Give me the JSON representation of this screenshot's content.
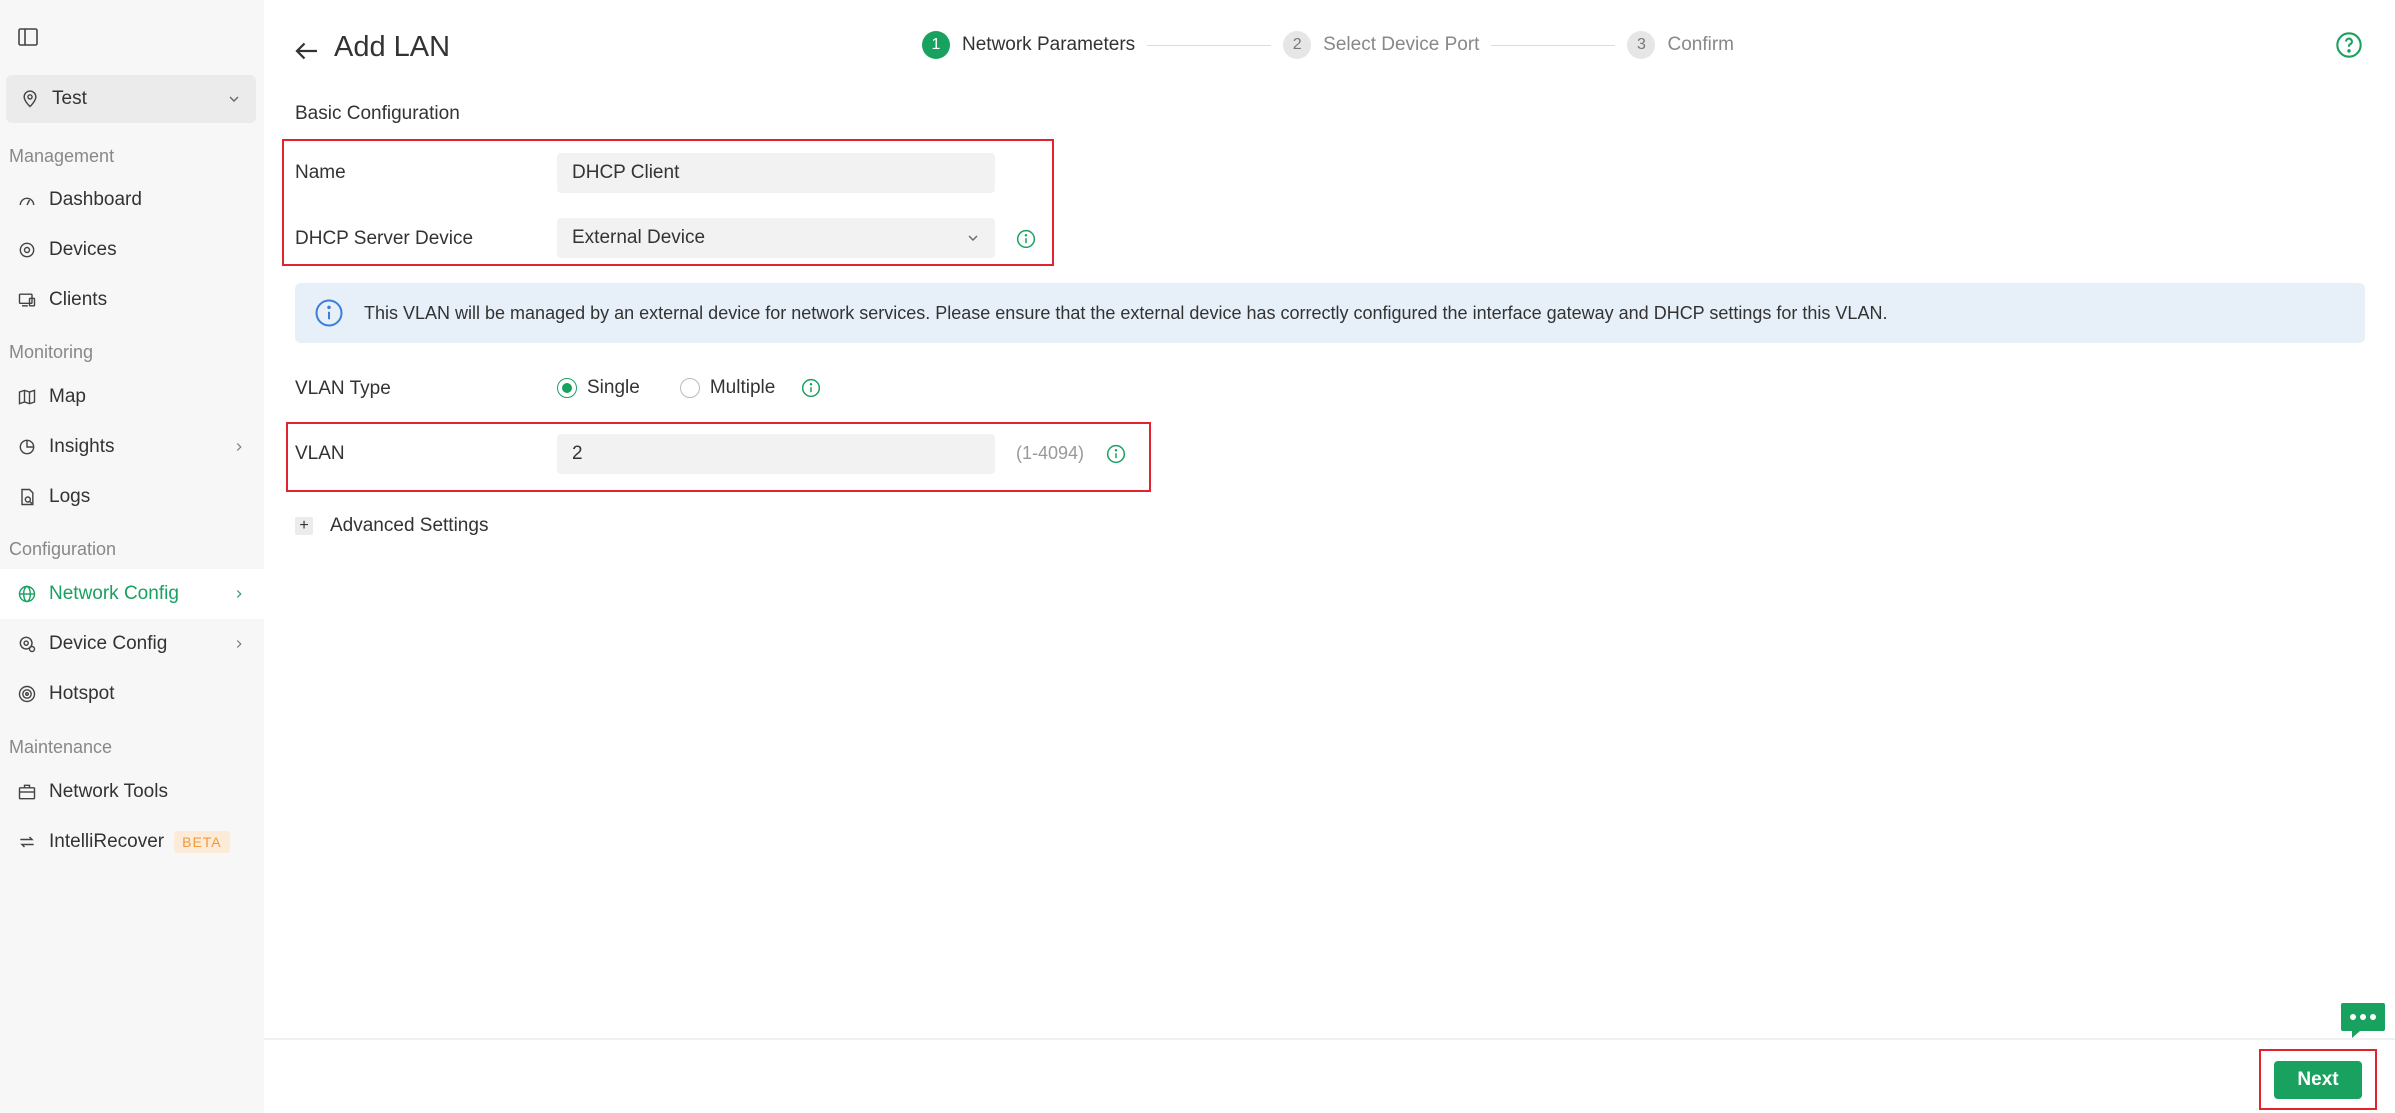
{
  "sidebar": {
    "site": "Test",
    "sections": {
      "management": "Management",
      "monitoring": "Monitoring",
      "configuration": "Configuration",
      "maintenance": "Maintenance"
    },
    "items": {
      "dashboard": "Dashboard",
      "devices": "Devices",
      "clients": "Clients",
      "map": "Map",
      "insights": "Insights",
      "logs": "Logs",
      "network_config": "Network Config",
      "device_config": "Device Config",
      "hotspot": "Hotspot",
      "network_tools": "Network Tools",
      "intellirecover": "IntelliRecover",
      "beta_badge": "BETA"
    },
    "active_item": "Network Config"
  },
  "header": {
    "title": "Add LAN"
  },
  "stepper": {
    "steps": [
      {
        "num": "1",
        "label": "Network Parameters",
        "state": "active"
      },
      {
        "num": "2",
        "label": "Select Device Port",
        "state": "idle"
      },
      {
        "num": "3",
        "label": "Confirm",
        "state": "idle"
      }
    ]
  },
  "form": {
    "section_title": "Basic Configuration",
    "name_label": "Name",
    "name_value": "DHCP Client",
    "dhcp_label": "DHCP Server Device",
    "dhcp_value": "External Device",
    "banner_text": "This VLAN will be managed by an external device for network services. Please ensure that the external device has correctly configured the interface gateway and DHCP settings for this VLAN.",
    "vlan_type_label": "VLAN Type",
    "vlan_type_options": [
      "Single",
      "Multiple"
    ],
    "vlan_type_selected": "Single",
    "vlan_label": "VLAN",
    "vlan_value": "2",
    "vlan_range": "(1-4094)",
    "advanced_label": "Advanced Settings"
  },
  "footer": {
    "next_label": "Next"
  },
  "colors": {
    "accent": "#19a15f",
    "highlight_box": "#e0232e",
    "banner_bg": "#e7f0f9",
    "info_blue": "#3b7dd8"
  }
}
